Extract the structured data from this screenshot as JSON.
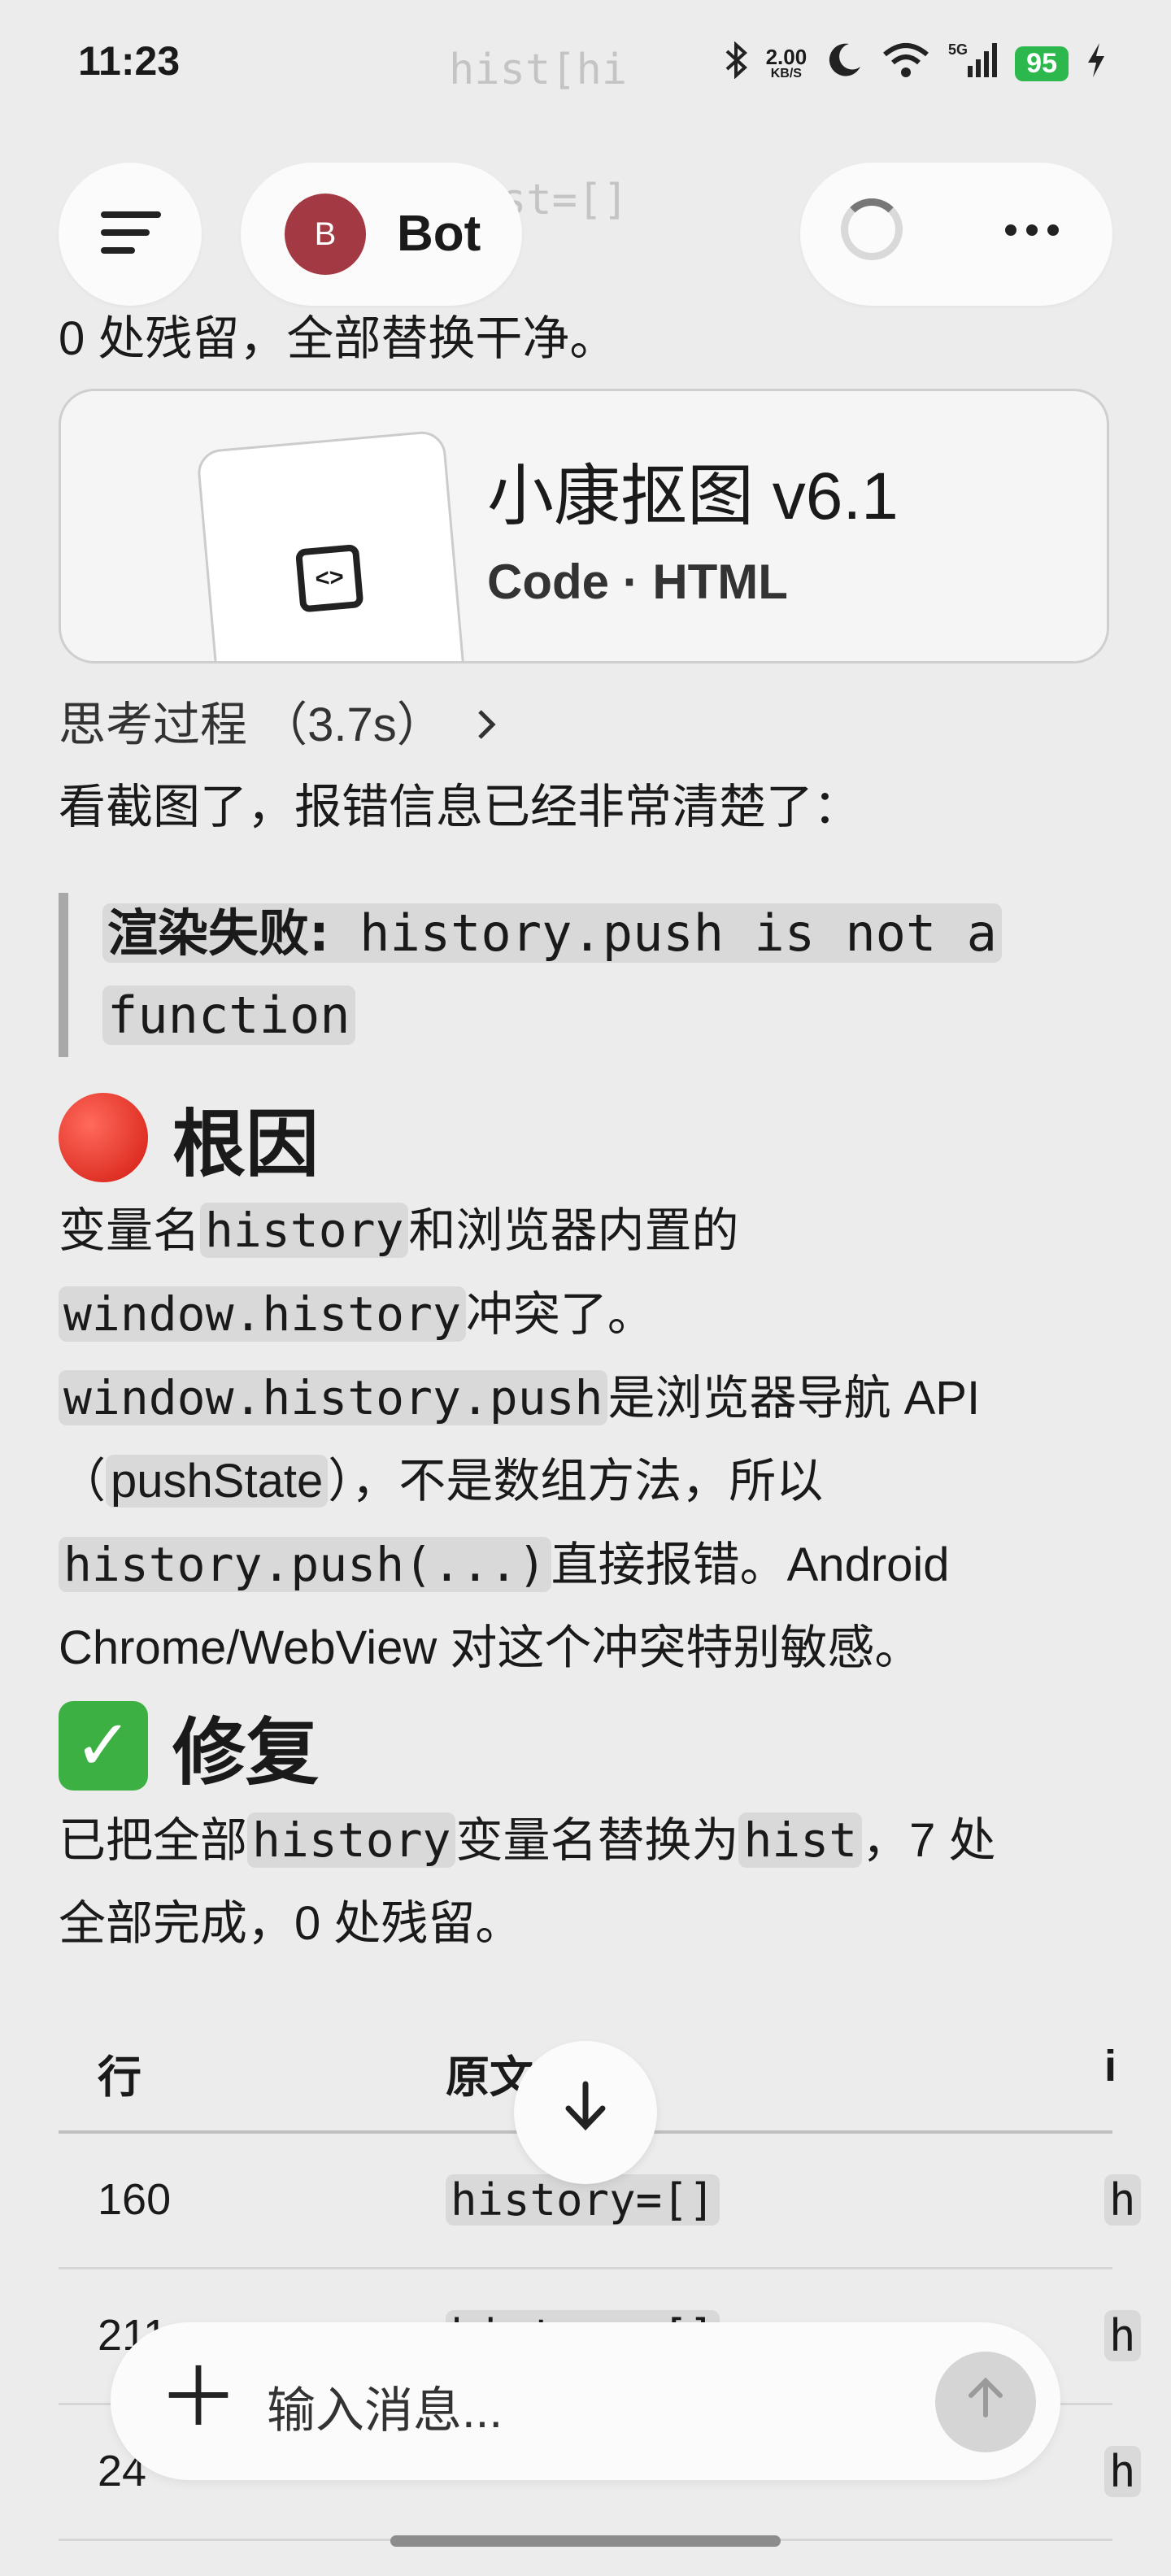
{
  "status_bar": {
    "time": "11:23",
    "net_speed_value": "2.00",
    "net_speed_unit": "KB/S",
    "signal": "5G",
    "battery": "95",
    "icons": [
      "bluetooth-icon",
      "moon-icon",
      "wifi-icon",
      "signal-icon",
      "charging-icon"
    ]
  },
  "ghost_text": {
    "line1": "hist[hi",
    "line2": "st=[]"
  },
  "header": {
    "bot_avatar_letter": "B",
    "bot_name": "Bot"
  },
  "messages": {
    "top_line": "0 处残留，全部替换干净。",
    "artifact": {
      "title": "小康抠图 v6.1",
      "subtitle": "Code · HTML",
      "icon": "code-file-icon"
    },
    "thinking": "思考过程 （3.7s）",
    "intro": "看截图了，报错信息已经非常清楚了：",
    "error_quote": {
      "prefix": "渲染失败:",
      "line1": " history.push is not a",
      "line2": "function"
    },
    "root_cause": {
      "heading": "根因",
      "p1_code1": "history",
      "p1_text1": "和浏览器内置的",
      "p1_code2": "window.history",
      "p1_text2": "冲突了。",
      "p2_code1": "window.history.push",
      "p2_text1": "是浏览器导航 API",
      "p3_text1": "（",
      "p3_code1": "pushState",
      "p3_text2": "），不是数组方法，所以",
      "p4_code1": "history.push(...)",
      "p4_text1": "直接报错。Android",
      "p5_text1": "Chrome/WebView 对这个冲突特别敏感。",
      "prefix": "变量名"
    },
    "fix": {
      "heading": "修复",
      "prefix": "已把全部",
      "code1": "history",
      "text1": "变量名替换为",
      "code2": "hist",
      "text2": "，7 处",
      "text3": "全部完成，0 处残留。"
    },
    "table": {
      "headers": [
        "行",
        "原文",
        "i"
      ],
      "rows": [
        [
          "160",
          "history=[]",
          "h"
        ],
        [
          "211",
          "history=[]",
          "h"
        ],
        [
          "24",
          "",
          "h"
        ]
      ]
    }
  },
  "composer": {
    "placeholder": "输入消息..."
  }
}
